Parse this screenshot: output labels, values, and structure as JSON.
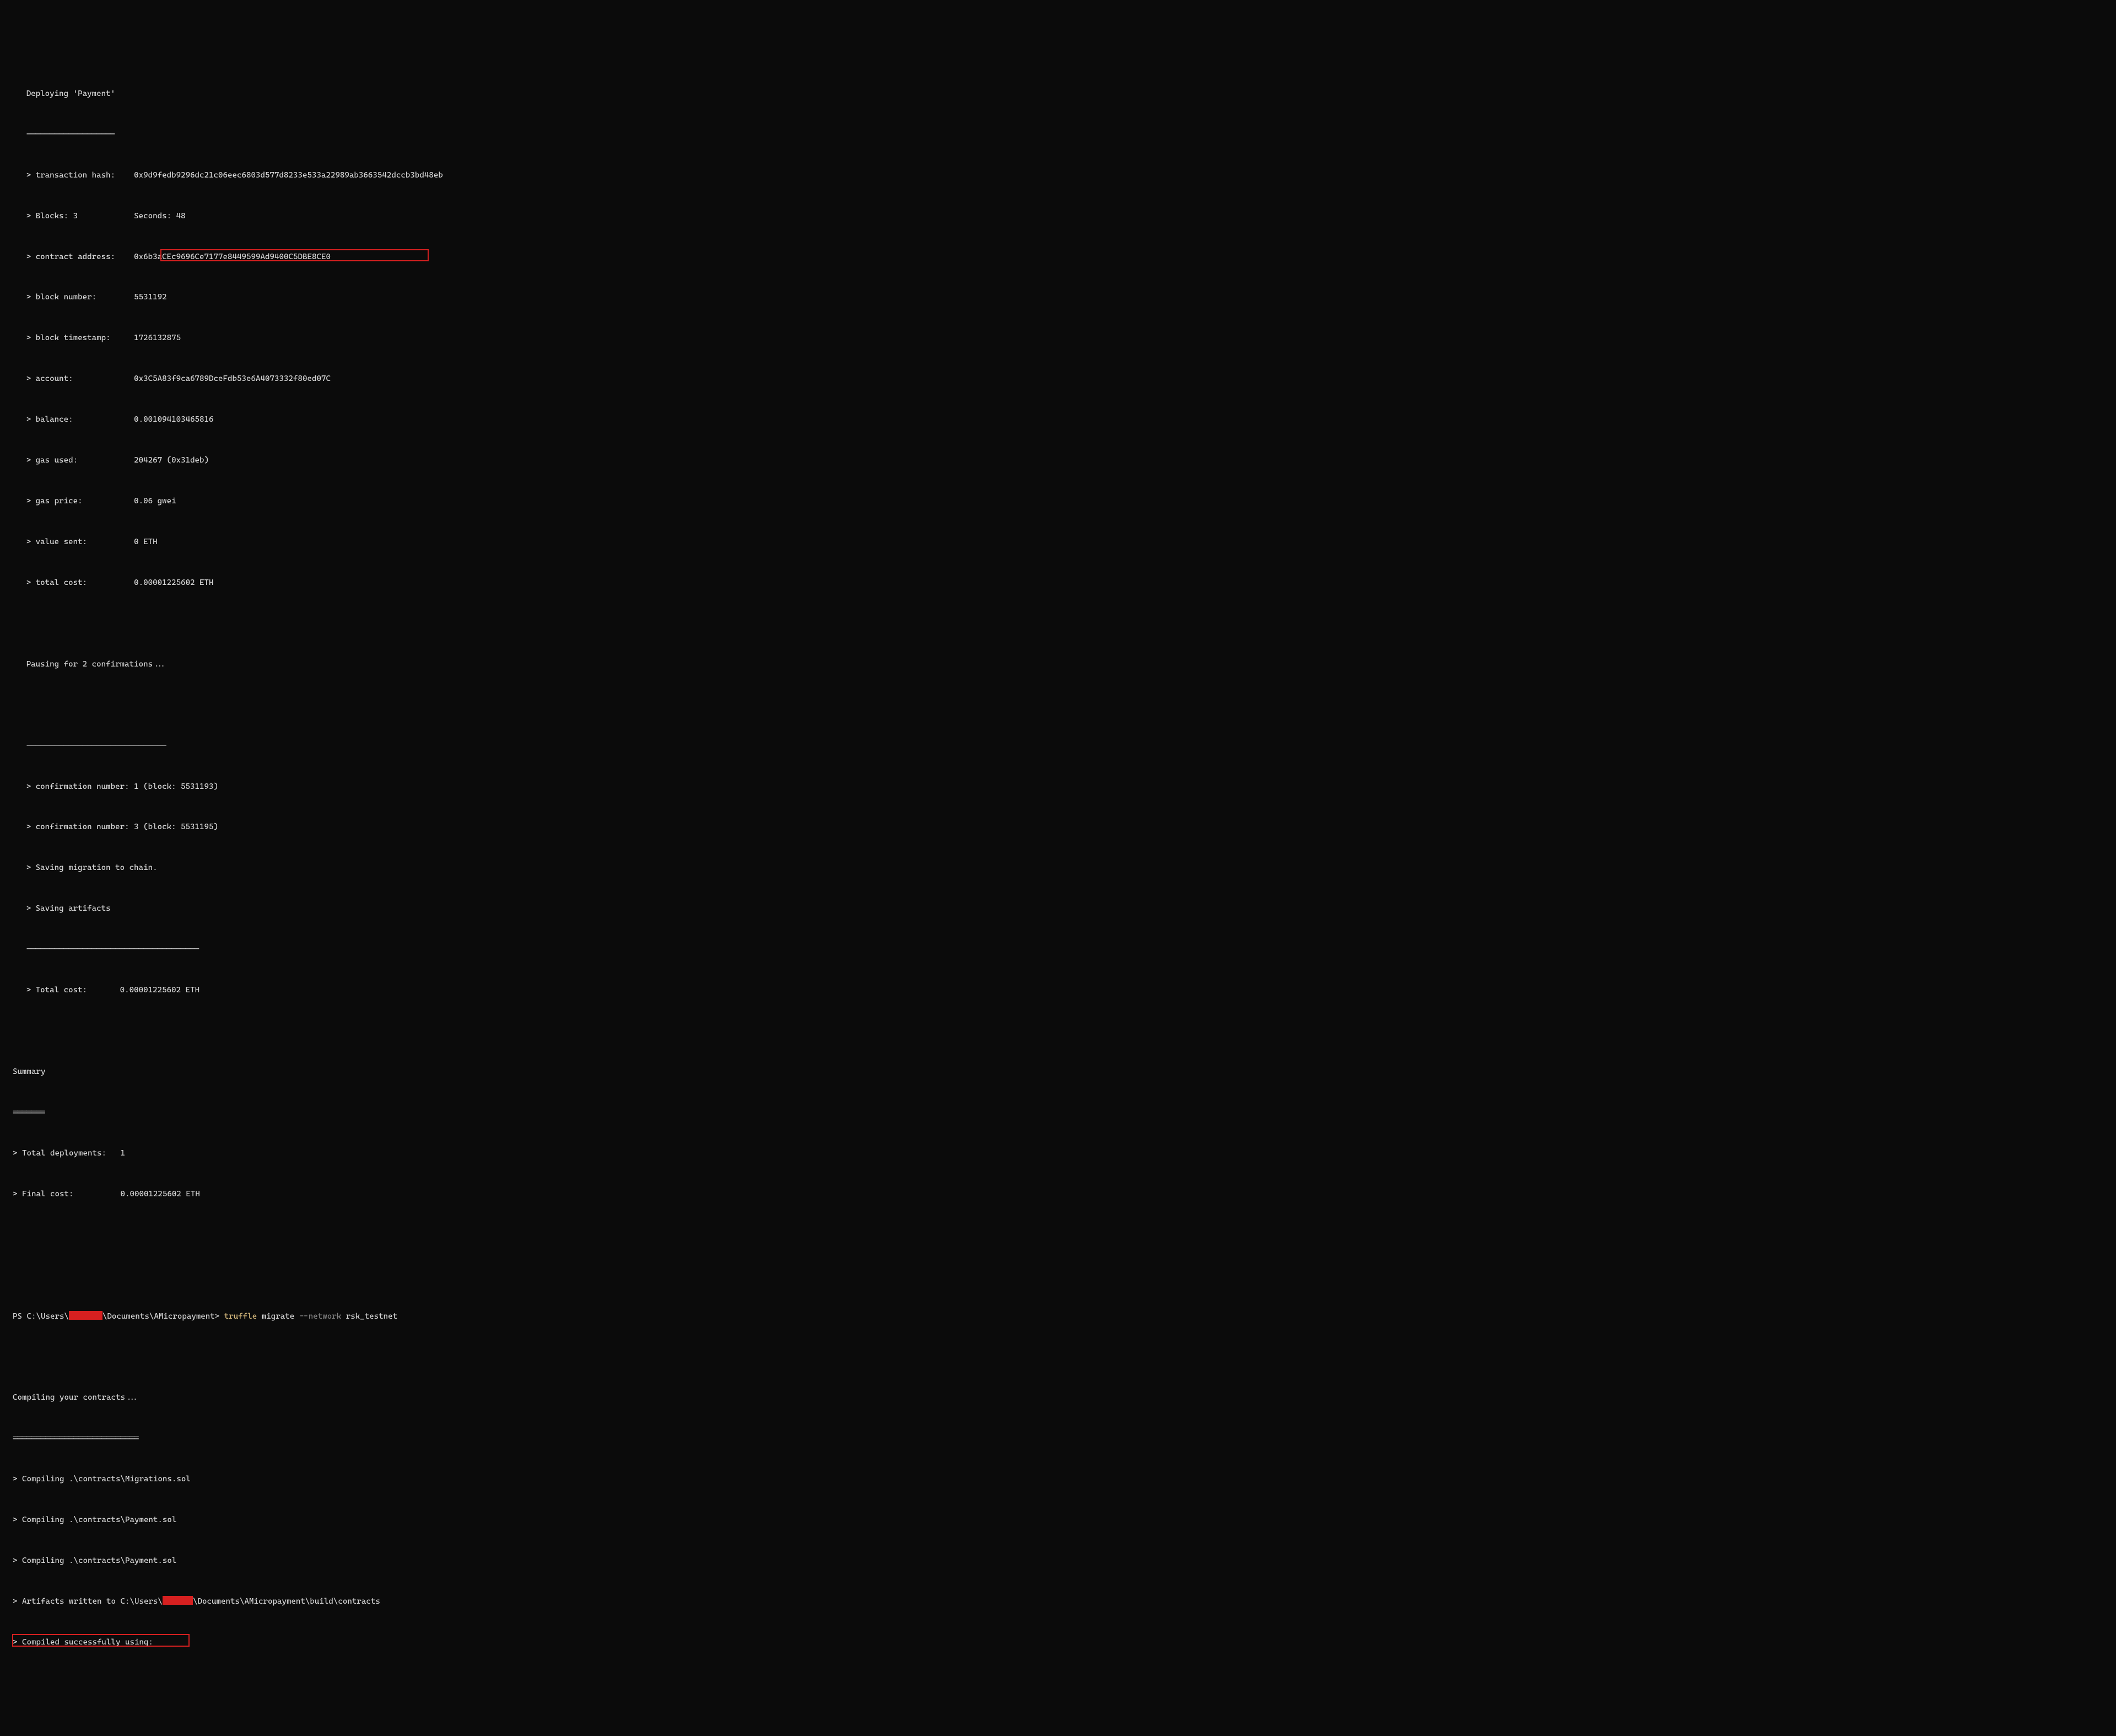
{
  "deploy": {
    "header": "Deploying 'Payment'",
    "underline": "-------------------",
    "lines": [
      {
        "label": "> transaction hash:",
        "pad": "    ",
        "value": "0x9d9fedb9296dc21c06eec6803d577d8233e533a22989ab3663542dccb3bd48eb"
      },
      {
        "label": "> Blocks: 3",
        "pad": "            ",
        "value": "Seconds: 48"
      },
      {
        "label": "> contract address:",
        "pad": "    ",
        "value": "0x6b3aCEc9696Ce7177e8449599Ad9400C5DBE8CE0",
        "highlight": true
      },
      {
        "label": "> block number:",
        "pad": "        ",
        "value": "5531192"
      },
      {
        "label": "> block timestamp:",
        "pad": "     ",
        "value": "1726132875"
      },
      {
        "label": "> account:",
        "pad": "             ",
        "value": "0x3C5A83f9ca6789DceFdb53e6A4073332f80ed07C"
      },
      {
        "label": "> balance:",
        "pad": "             ",
        "value": "0.001094103465816"
      },
      {
        "label": "> gas used:",
        "pad": "            ",
        "value": "204267 (0x31deb)"
      },
      {
        "label": "> gas price:",
        "pad": "           ",
        "value": "0.06 gwei"
      },
      {
        "label": "> value sent:",
        "pad": "          ",
        "value": "0 ETH"
      },
      {
        "label": "> total cost:",
        "pad": "          ",
        "value": "0.00001225602 ETH"
      }
    ],
    "pausing": "Pausing for 2 confirmations...",
    "dash1": "------------------------------",
    "confirmations": [
      "> confirmation number: 1 (block: 5531193)",
      "> confirmation number: 3 (block: 5531195)"
    ],
    "saving": [
      "> Saving migration to chain.",
      "> Saving artifacts"
    ],
    "dash2": "-------------------------------------",
    "totalCostLabel": "> Total cost:",
    "totalCostPad": "       ",
    "totalCostValue": "0.00001225602 ETH"
  },
  "summary": {
    "header": "Summary",
    "underline": "=======",
    "deployments": "> Total deployments:   1",
    "finalCost": "> Final cost:          0.00001225602 ETH"
  },
  "prompt": {
    "prefix": "PS C:\\Users\\",
    "afterRedact": "\\Documents\\AMicropayment> ",
    "cmd1": "truffle ",
    "cmd2": "migrate ",
    "flag": "--network",
    "arg": " rsk_testnet"
  },
  "compile": {
    "header": "Compiling your contracts...",
    "underline": "===========================",
    "lines": [
      "> Compiling .\\contracts\\Migrations.sol",
      "> Compiling .\\contracts\\Payment.sol",
      "> Compiling .\\contracts\\Payment.sol"
    ],
    "artifactsPrefix": "> Artifacts written to C:\\Users\\",
    "artifactsSuffix": "\\Documents\\AMicropayment\\build\\contracts",
    "compiled": "> Compiled successfully using:"
  }
}
